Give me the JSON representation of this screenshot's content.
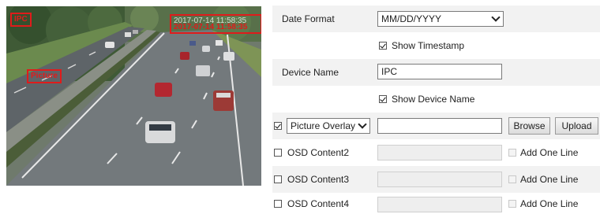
{
  "preview": {
    "osd_name": "IPC",
    "osd_picture": "Picture",
    "osd_time_ghost": "2017-07-14 11:58:35",
    "osd_time": "2017-07-14 11:58:35"
  },
  "settings": {
    "date_format": {
      "label": "Date Format",
      "value": "MM/DD/YYYY"
    },
    "show_timestamp": {
      "label": "Show Timestamp",
      "checked": true
    },
    "device_name": {
      "label": "Device Name",
      "value": "IPC"
    },
    "show_device_name": {
      "label": "Show Device Name",
      "checked": true
    },
    "picture_overlay": {
      "select_value": "Picture Overlay",
      "checked": true,
      "text_value": "",
      "browse_label": "Browse",
      "upload_label": "Upload"
    },
    "osd_rows": [
      {
        "label": "OSD Content2",
        "add_line_label": "Add One Line"
      },
      {
        "label": "OSD Content3",
        "add_line_label": "Add One Line"
      },
      {
        "label": "OSD Content4",
        "add_line_label": "Add One Line"
      }
    ]
  },
  "icons": {
    "checkbox": "checkbox-icon",
    "dropdown": "chevron-down-icon"
  }
}
